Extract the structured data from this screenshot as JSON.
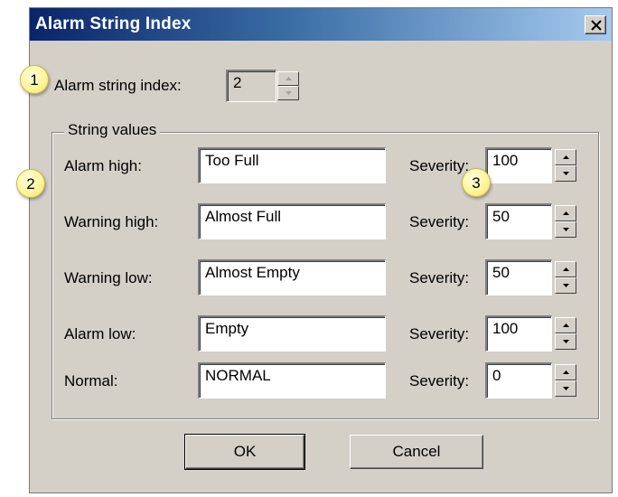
{
  "window": {
    "title": "Alarm String Index",
    "close_icon": "close-icon"
  },
  "index": {
    "label": "Alarm string index:",
    "value": "2"
  },
  "group": {
    "legend": "String values",
    "rows": [
      {
        "label": "Alarm high:",
        "value": "Too Full",
        "severity_label": "Severity:",
        "severity": "100"
      },
      {
        "label": "Warning high:",
        "value": "Almost Full",
        "severity_label": "Severity:",
        "severity": "50"
      },
      {
        "label": "Warning low:",
        "value": "Almost Empty",
        "severity_label": "Severity:",
        "severity": "50"
      },
      {
        "label": "Alarm low:",
        "value": "Empty",
        "severity_label": "Severity:",
        "severity": "100"
      },
      {
        "label": "Normal:",
        "value": "NORMAL",
        "severity_label": "Severity:",
        "severity": "0"
      }
    ]
  },
  "buttons": {
    "ok": "OK",
    "cancel": "Cancel"
  },
  "callouts": [
    "1",
    "2",
    "3"
  ],
  "colors": {
    "title_start": "#0a246a",
    "title_end": "#a6caf0",
    "face": "#d4d0c8",
    "callout": "#fff59a"
  }
}
